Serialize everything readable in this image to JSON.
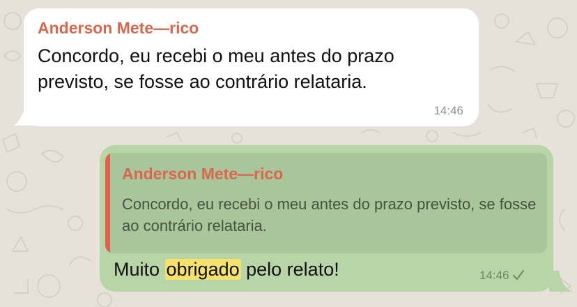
{
  "incoming_message": {
    "sender": "Anderson Mete—rico",
    "text": "Concordo, eu recebi o meu antes do prazo previsto, se fosse ao contrário relataria.",
    "time": "14:46"
  },
  "outgoing_message": {
    "quoted": {
      "sender": "Anderson Mete—rico",
      "text": "Concordo, eu recebi o meu antes do prazo previsto, se fosse ao contrário relataria."
    },
    "text_before": "Muito ",
    "text_highlight": "obrigado",
    "text_after": " pelo relato!",
    "time": "14:46",
    "status_icon": "single-check-icon"
  },
  "colors": {
    "incoming_bubble": "#ffffff",
    "outgoing_bubble": "#b8d5a7",
    "quote_background": "#a9c69a",
    "sender_name": "#d8674f",
    "quote_bar": "#e4604c",
    "highlight": "#f5e16b",
    "wallpaper": "#e7e2d9"
  }
}
